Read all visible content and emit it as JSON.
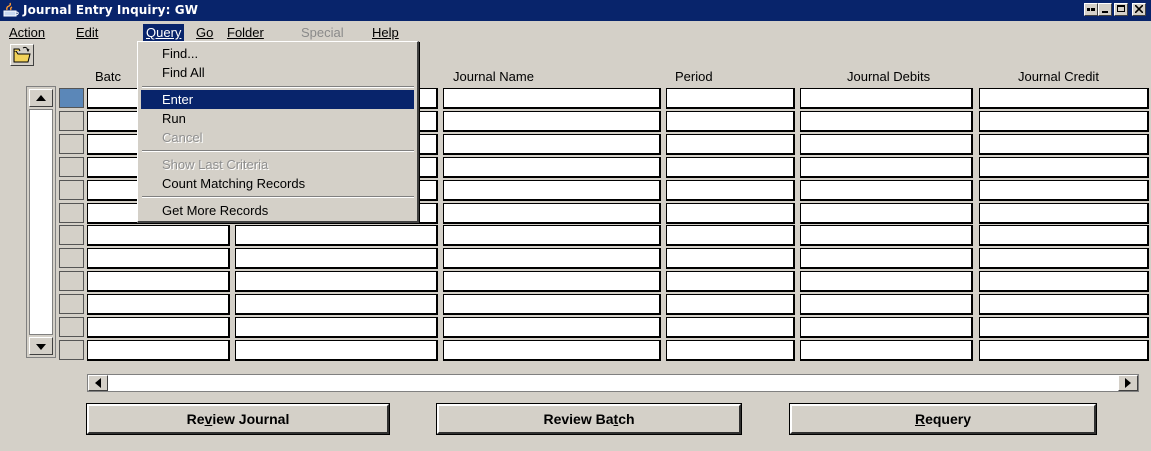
{
  "window": {
    "title": "Journal Entry Inquiry: GW"
  },
  "menubar": {
    "items": [
      {
        "label": "Action",
        "state": "normal"
      },
      {
        "label": "Edit",
        "state": "normal"
      },
      {
        "label": "Query",
        "state": "active"
      },
      {
        "label": "Go",
        "state": "normal"
      },
      {
        "label": "Folder",
        "state": "normal"
      },
      {
        "label": "Special",
        "state": "disabled"
      },
      {
        "label": "Help",
        "state": "normal"
      }
    ]
  },
  "toolbar": {
    "open_icon": "open-folder-icon"
  },
  "grid": {
    "columns": [
      "Batc",
      "Journal Name",
      "Period",
      "Journal Debits",
      "Journal Credit"
    ],
    "row_count": 12,
    "current_row": 1
  },
  "query_menu": {
    "items": [
      {
        "label": "Find...",
        "state": "normal"
      },
      {
        "label": "Find All",
        "state": "normal"
      },
      {
        "label": "Enter",
        "state": "highlighted"
      },
      {
        "label": "Run",
        "state": "normal"
      },
      {
        "label": "Cancel",
        "state": "disabled"
      },
      {
        "label": "Show Last Criteria",
        "state": "disabled"
      },
      {
        "label": "Count Matching Records",
        "state": "normal"
      },
      {
        "label": "Get More Records",
        "state": "normal"
      }
    ]
  },
  "buttons": {
    "review_journal": "Review Journal",
    "review_batch": "Review Batch",
    "requery": "Requery"
  },
  "colors": {
    "title_bar": "#08246b",
    "window_bg": "#d4d0c8",
    "current_row": "#5b87b8"
  }
}
